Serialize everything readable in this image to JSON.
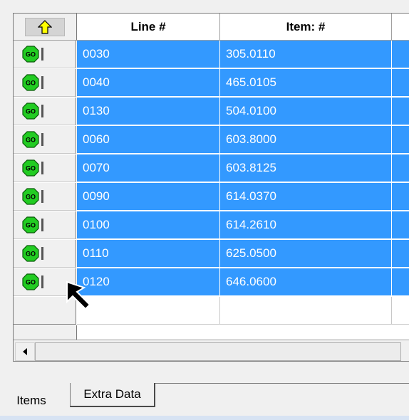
{
  "grid": {
    "sort_icon": "up-arrow-icon",
    "columns": [
      "Line #",
      "Item: #"
    ],
    "rows": [
      {
        "line": "0030",
        "item": "305.0110"
      },
      {
        "line": "0040",
        "item": "465.0105"
      },
      {
        "line": "0130",
        "item": "504.0100"
      },
      {
        "line": "0060",
        "item": "603.8000"
      },
      {
        "line": "0070",
        "item": "603.8125"
      },
      {
        "line": "0090",
        "item": "614.0370"
      },
      {
        "line": "0100",
        "item": "614.2610"
      },
      {
        "line": "0110",
        "item": "625.0500"
      },
      {
        "line": "0120",
        "item": "646.0600"
      }
    ],
    "go_label": "GO",
    "selection_color": "#3399ff"
  },
  "tabs": {
    "items": "Items",
    "extra": "Extra Data"
  }
}
